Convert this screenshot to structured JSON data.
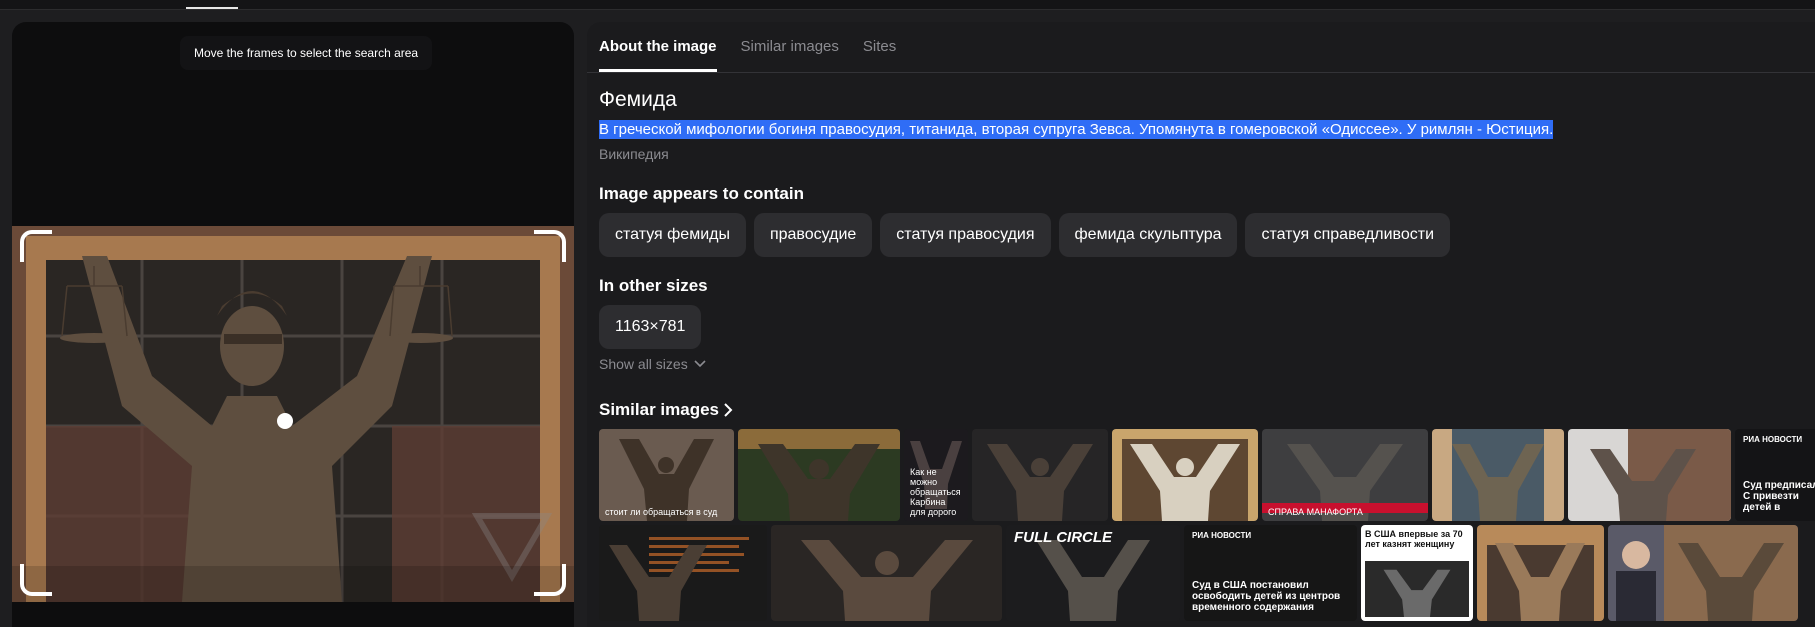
{
  "left_panel": {
    "hint": "Move the frames to select the search area"
  },
  "tabs": [
    {
      "label": "About the image",
      "active": true
    },
    {
      "label": "Similar images",
      "active": false
    },
    {
      "label": "Sites",
      "active": false
    }
  ],
  "entity": {
    "title": "Фемида",
    "description": "В греческой мифологии богиня правосудия, титанида, вторая супруга Зевса. Упомянута в гомеровской «Одиссее». У римлян - Юстиция.",
    "source": "Википедия"
  },
  "contains": {
    "title": "Image appears to contain",
    "chips": [
      "статуя фемиды",
      "правосудие",
      "статуя правосудия",
      "фемида скульптура",
      "статуя справедливости"
    ]
  },
  "sizes": {
    "title": "In other sizes",
    "chips": [
      "1163×781"
    ],
    "show_all": "Show all sizes"
  },
  "similar": {
    "title": "Similar images",
    "row1_captions": [
      "стоит ли обращаться в суд",
      "",
      "Как не можно обращаться Карбина для дорого",
      "",
      "",
      "СПРАВА МАНАФОРТА",
      "",
      "",
      "Суд предписал С привезти детей в"
    ],
    "row1_badge": "РИА НОВОСТИ",
    "row2_overlay": "FULL CIRCLE",
    "row2_ria": "РИА НОВОСТИ",
    "row2_ria_caption": "Суд в США постановил освободить детей из центров временного содержания",
    "row2_white_title": "В США впервые за 70 лет казнят женщину"
  },
  "colors": {
    "accent_highlight": "#2f6df6",
    "panel_bg": "#1b1b1d",
    "chip_bg": "#2d2d30"
  }
}
